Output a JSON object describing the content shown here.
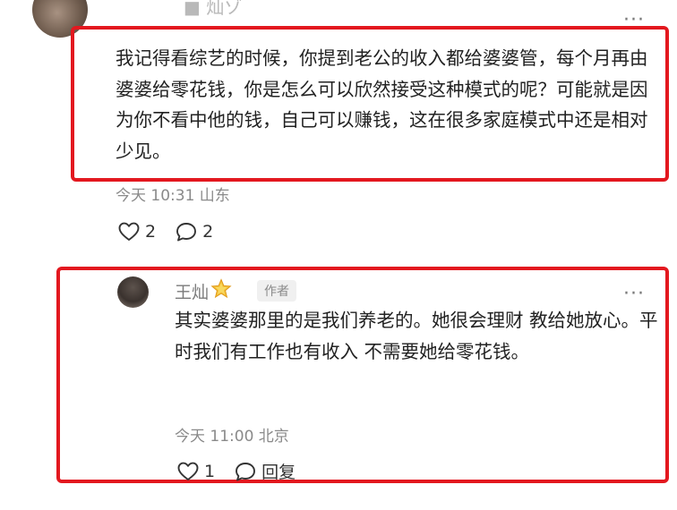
{
  "comment": {
    "author_partial": "■ 灿ゾ",
    "text": "我记得看综艺的时候，你提到老公的收入都给婆婆管，每个月再由婆婆给零花钱，你是怎么可以欣然接受这种模式的呢？可能就是因为你不看中他的钱，自己可以赚钱，这在很多家庭模式中还是相对少见。",
    "meta": "今天 10:31 山东",
    "likes": "2",
    "replies": "2",
    "icons": {
      "like": "heart-outline-icon",
      "comment": "speech-bubble-icon",
      "more": "more-dots-icon"
    }
  },
  "reply": {
    "author": "王灿",
    "author_badge": "作者",
    "text": "其实婆婆那里的是我们养老的。她很会理财 教给她放心。平时我们有工作也有收入 不需要她给零花钱。",
    "meta": "今天 11:00 北京",
    "likes": "1",
    "reply_label": "回复",
    "icons": {
      "verified": "star-badge-icon",
      "like": "heart-outline-icon",
      "comment": "speech-bubble-icon",
      "more": "more-dots-icon"
    }
  },
  "colors": {
    "highlight": "#e3181f",
    "meta_text": "#8a8a8a",
    "body_text": "#222222"
  }
}
